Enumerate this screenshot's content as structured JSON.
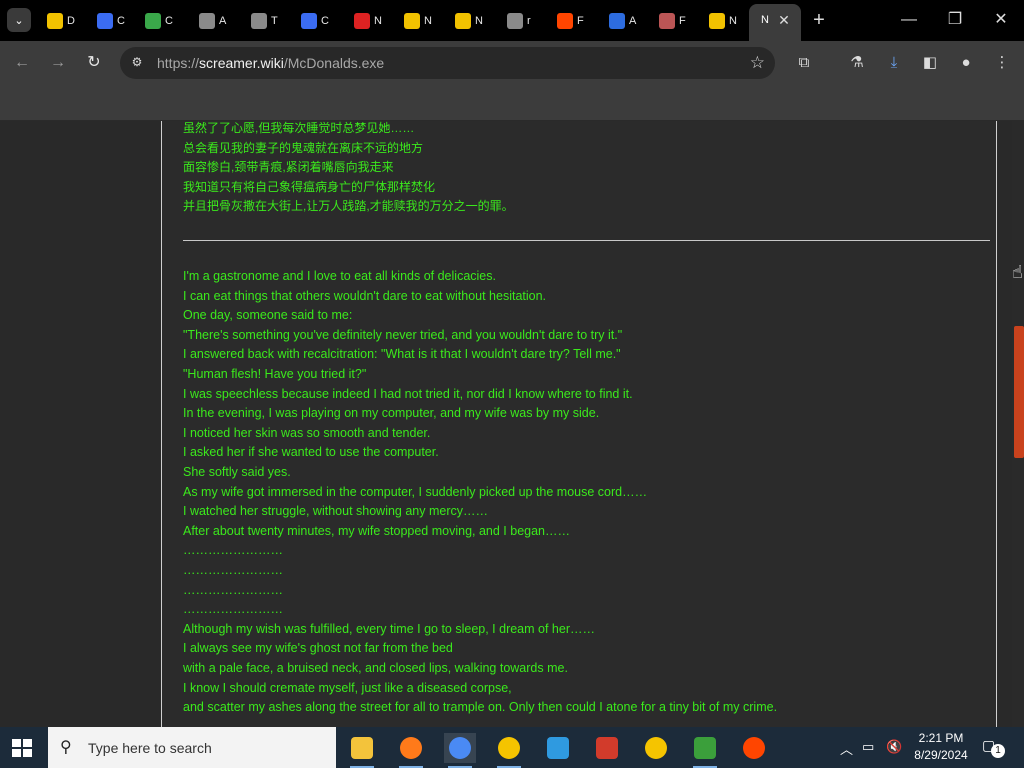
{
  "browser": {
    "tabs": [
      {
        "label": "D",
        "color": "#f2c200"
      },
      {
        "label": "C",
        "color": "#3b6cf2"
      },
      {
        "label": "C",
        "color": "#3aa84a"
      },
      {
        "label": "A",
        "color": "#8a8a8a"
      },
      {
        "label": "T",
        "color": "#8a8a8a"
      },
      {
        "label": "C",
        "color": "#3b6cf2"
      },
      {
        "label": "N",
        "color": "#d22"
      },
      {
        "label": "N",
        "color": "#f2c200"
      },
      {
        "label": "N",
        "color": "#f2c200"
      },
      {
        "label": "r",
        "color": "#8a8a8a"
      },
      {
        "label": "F",
        "color": "#ff4500"
      },
      {
        "label": "A",
        "color": "#2d6cdf"
      },
      {
        "label": "F",
        "color": "#b55"
      },
      {
        "label": "N",
        "color": "#f2c200"
      }
    ],
    "active_tab": {
      "label": "N"
    },
    "new_tab_symbol": "+",
    "url_scheme": "https://",
    "url_host": "screamer.wiki",
    "url_path": "/McDonalds.exe"
  },
  "page": {
    "chinese_lines": [
      "虽然了了心愿,但我每次睡觉时总梦见她……",
      "总会看见我的妻子的鬼魂就在离床不远的地方",
      "面容惨白,颈带青痕,紧闭着嘴唇向我走来",
      "我知道只有将自己象得瘟病身亡的尸体那样焚化",
      "并且把骨灰撒在大街上,让万人践踏,才能赎我的万分之一的罪。"
    ],
    "english_lines": [
      "I'm a gastronome and I love to eat all kinds of delicacies.",
      "I can eat things that others wouldn't dare to eat without hesitation.",
      "One day, someone said to me:",
      "\"There's something you've definitely never tried, and you wouldn't dare to try it.\"",
      "I answered back with recalcitration: \"What is it that I wouldn't dare try? Tell me.\"",
      "\"Human flesh! Have you tried it?\"",
      "I was speechless because indeed I had not tried it, nor did I know where to find it.",
      "In the evening, I was playing on my computer, and my wife was by my side.",
      "I noticed her skin was so smooth and tender.",
      "I asked her if she wanted to use the computer.",
      "She softly said yes.",
      "As my wife got immersed in the computer, I suddenly picked up the mouse cord……",
      "I watched her struggle, without showing any mercy……",
      "After about twenty minutes, my wife stopped moving, and I began……",
      "……………………",
      "……………………",
      "……………………",
      "……………………",
      "Although my wish was fulfilled, every time I go to sleep, I dream of her……",
      "I always see my wife's ghost not far from the bed",
      "with a pale face, a bruised neck, and closed lips, walking towards me.",
      "I know I should cremate myself, just like a diseased corpse,",
      "and scatter my ashes along the street for all to trample on. Only then could I atone for a tiny bit of my crime."
    ]
  },
  "taskbar": {
    "search_placeholder": "Type here to search",
    "time": "2:21 PM",
    "date": "8/29/2024",
    "notification_count": "1",
    "apps": [
      "file-explorer",
      "firefox",
      "chrome",
      "rtl-app",
      "microsoft-store",
      "app-red",
      "rtl-app-2",
      "app-green",
      "reddit"
    ]
  },
  "colors": {
    "text_green": "#3bea1c",
    "scroll_thumb": "#c9421d"
  }
}
